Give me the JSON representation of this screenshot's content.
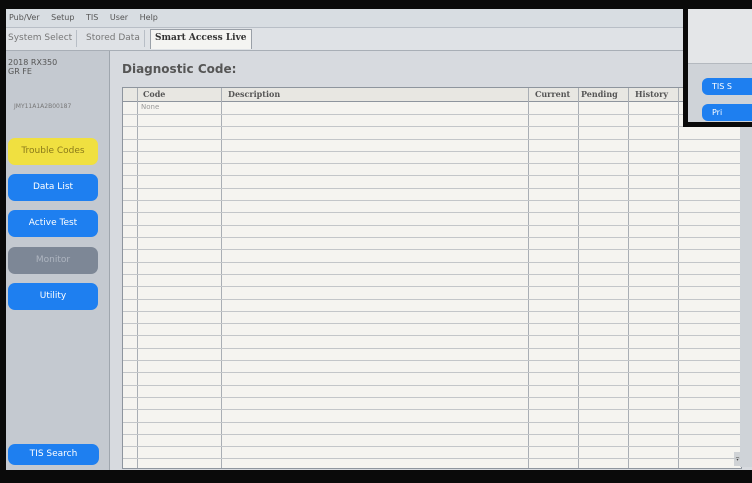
{
  "menu": [
    "Pub/Ver",
    "Setup",
    "TIS",
    "User",
    "Help"
  ],
  "tabs": [
    {
      "label": "System Select",
      "active": false
    },
    {
      "label": "Stored Data",
      "active": false
    },
    {
      "label": "Smart Access Live",
      "active": true
    }
  ],
  "vehicle": {
    "line1": "2018 RX350",
    "line2": "GR FE",
    "vin": "JMY11A1A2B00187"
  },
  "sidebar": {
    "buttons": [
      {
        "label": "Trouble Codes",
        "style": "yellow"
      },
      {
        "label": "Data List",
        "style": "blue"
      },
      {
        "label": "Active Test",
        "style": "blue"
      },
      {
        "label": "Monitor",
        "style": "gray"
      },
      {
        "label": "Utility",
        "style": "blue"
      }
    ],
    "tis_search": "TIS Search"
  },
  "main": {
    "title": "Diagnostic Code:",
    "columns": [
      "",
      "Code",
      "Description",
      "Current",
      "Pending",
      "History",
      ""
    ],
    "rows": [
      {
        "code": "None",
        "description": "",
        "current": "",
        "pending": "",
        "history": ""
      }
    ],
    "scroll_down": "▾"
  },
  "inset": {
    "button1": "TIS S",
    "button2": "Pri"
  },
  "colors": {
    "yellow_button": "#f0e040",
    "blue_button": "#1e7ff0",
    "gray_button": "#7d8796"
  }
}
